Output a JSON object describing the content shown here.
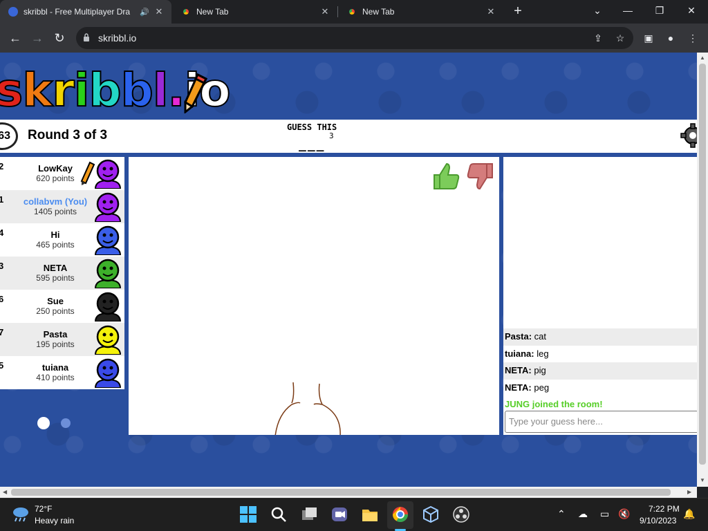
{
  "browser": {
    "tabs": [
      {
        "title": "skribbl - Free Multiplayer Dra",
        "active": true,
        "icon": "skribbl-favicon"
      },
      {
        "title": "New Tab",
        "active": false,
        "icon": "chrome-icon"
      },
      {
        "title": "New Tab",
        "active": false,
        "icon": "chrome-icon"
      }
    ],
    "url": "skribbl.io",
    "window_controls": {
      "minimize": "—",
      "restore": "❐",
      "close": "✕"
    }
  },
  "game": {
    "logo_text": "skribbl.io",
    "logo_letter_colors": [
      "#e0231a",
      "#f07a12",
      "#f2d400",
      "#2bd01a",
      "#23d7c5",
      "#2a62ec",
      "#9b2ad6",
      "#e82ad5",
      "#ffffff",
      "#ffffff"
    ],
    "timer": "63",
    "round_text": "Round 3 of 3",
    "guess_label": "GUESS THIS",
    "letter_count": "3",
    "word_hint": "___",
    "players": [
      {
        "rank": "2",
        "name": "LowKay",
        "score": "620 points",
        "you": false,
        "avatar_color": "#a020f0",
        "drawing": true
      },
      {
        "rank": "1",
        "name": "collabvm (You)",
        "score": "1405 points",
        "you": true,
        "avatar_color": "#a020f0",
        "drawing": false
      },
      {
        "rank": "4",
        "name": "Hi",
        "score": "465 points",
        "you": false,
        "avatar_color": "#3a5ee8",
        "drawing": false
      },
      {
        "rank": "3",
        "name": "NETA",
        "score": "595 points",
        "you": false,
        "avatar_color": "#3db02a",
        "drawing": false
      },
      {
        "rank": "6",
        "name": "Sue",
        "score": "250 points",
        "you": false,
        "avatar_color": "#222222",
        "drawing": false
      },
      {
        "rank": "7",
        "name": "Pasta",
        "score": "195 points",
        "you": false,
        "avatar_color": "#f5f20a",
        "drawing": false
      },
      {
        "rank": "5",
        "name": "tuiana",
        "score": "410 points",
        "you": false,
        "avatar_color": "#3a4ae8",
        "drawing": false
      }
    ],
    "chat": [
      {
        "user": "Pasta:",
        "text": "cat"
      },
      {
        "user": "tuiana:",
        "text": "leg"
      },
      {
        "user": "NETA:",
        "text": "pig"
      },
      {
        "user": "NETA:",
        "text": "peg"
      }
    ],
    "join_message": "JUNG joined the room!",
    "guess_placeholder": "Type your guess here..."
  },
  "taskbar": {
    "weather_temp": "72°F",
    "weather_desc": "Heavy rain",
    "time": "7:22 PM",
    "date": "9/10/2023"
  }
}
